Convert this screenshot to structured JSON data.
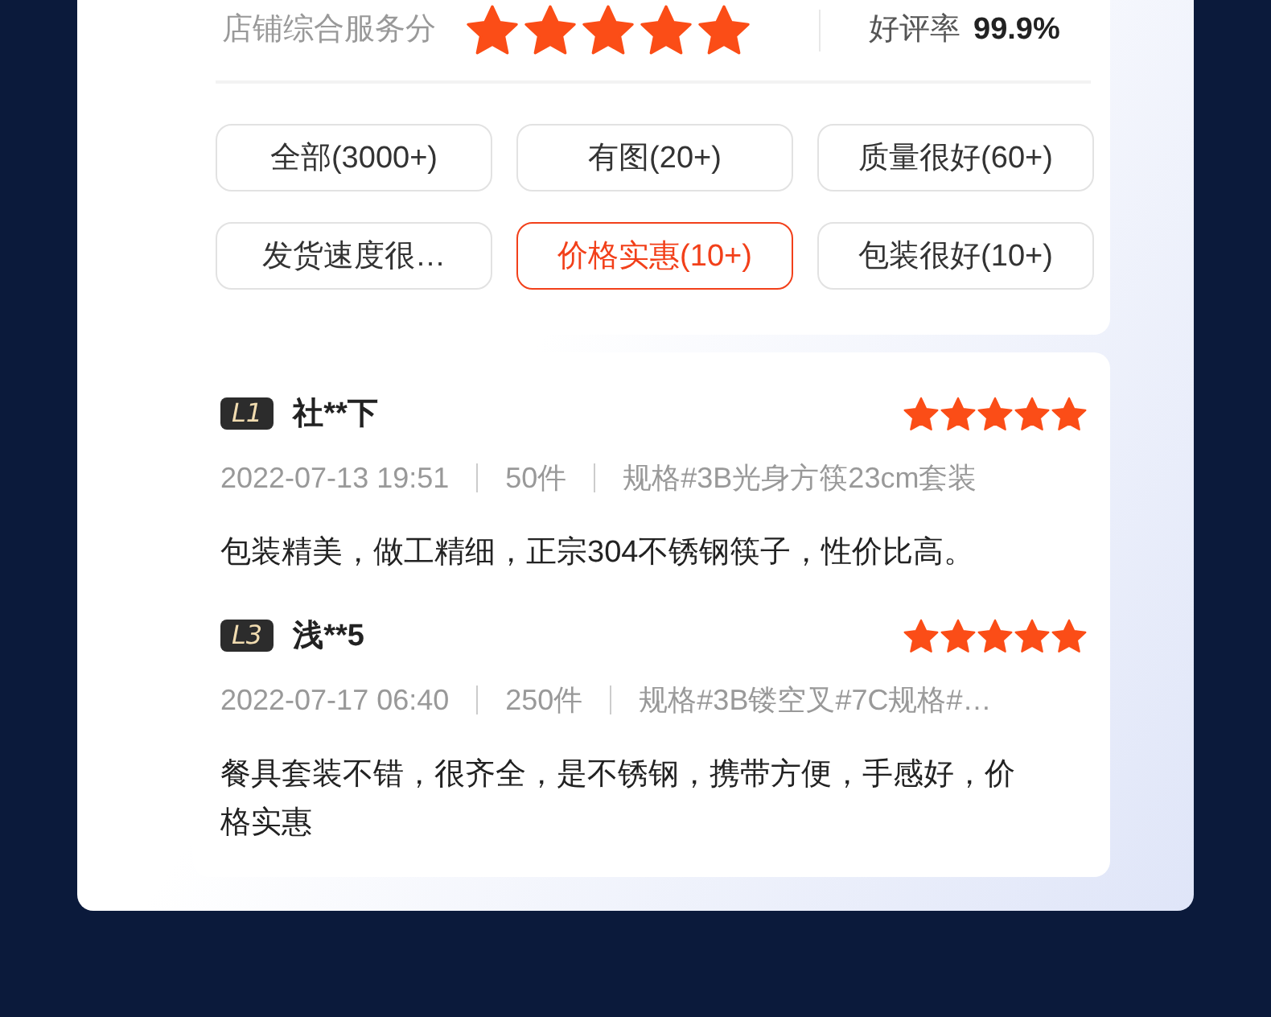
{
  "store_score": {
    "label": "店铺综合服务分",
    "stars": 5,
    "rate_label": "好评率",
    "rate_value": "99.9%"
  },
  "filters": [
    {
      "label": "全部(3000+)",
      "selected": false
    },
    {
      "label": "有图(20+)",
      "selected": false
    },
    {
      "label": "质量很好(60+)",
      "selected": false
    },
    {
      "label": "发货速度很…",
      "selected": false
    },
    {
      "label": "价格实惠(10+)",
      "selected": true
    },
    {
      "label": "包装很好(10+)",
      "selected": false
    }
  ],
  "reviews": [
    {
      "level": "L1",
      "user": "社**下",
      "stars": 5,
      "date": "2022-07-13 19:51",
      "quantity": "50件",
      "spec": "规格#3B光身方筷23cm套装",
      "text": "包装精美，做工精细，正宗304不锈钢筷子，性价比高。"
    },
    {
      "level": "L3",
      "user": "浅**5",
      "stars": 5,
      "date": "2022-07-17 06:40",
      "quantity": "250件",
      "spec": "规格#3B镂空叉#7C规格#…",
      "text": "餐具套装不错，很齐全，是不锈钢，携带方便，手感好，价格实惠"
    }
  ]
}
